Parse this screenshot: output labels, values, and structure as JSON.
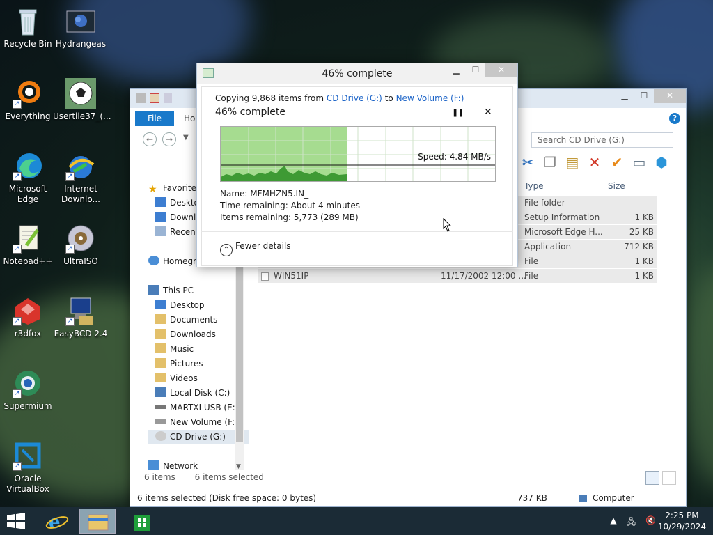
{
  "desktop": {
    "icons": [
      {
        "label": "Recycle Bin"
      },
      {
        "label": "Hydrangeas"
      },
      {
        "label": "Everything"
      },
      {
        "label": "Usertile37_(..."
      },
      {
        "label": "Microsoft Edge"
      },
      {
        "label": "Internet Downlo..."
      },
      {
        "label": "Notepad++"
      },
      {
        "label": "UltraISO"
      },
      {
        "label": "r3dfox"
      },
      {
        "label": "EasyBCD 2.4"
      },
      {
        "label": "Supermium"
      },
      {
        "label": "Oracle VirtualBox"
      }
    ]
  },
  "explorer": {
    "tabs": {
      "file": "File",
      "home": "Ho"
    },
    "search_placeholder": "Search CD Drive (G:)",
    "sidebar": [
      {
        "label": "Favorites"
      },
      {
        "label": "Deskto"
      },
      {
        "label": "Downl"
      },
      {
        "label": "Recent"
      },
      {
        "label": "Homegr"
      },
      {
        "label": "This PC"
      },
      {
        "label": "Desktop"
      },
      {
        "label": "Documents"
      },
      {
        "label": "Downloads"
      },
      {
        "label": "Music"
      },
      {
        "label": "Pictures"
      },
      {
        "label": "Videos"
      },
      {
        "label": "Local Disk (C:)"
      },
      {
        "label": "MARTXI USB (E:)"
      },
      {
        "label": "New Volume (F:)"
      },
      {
        "label": "CD Drive (G:)"
      },
      {
        "label": "Network"
      }
    ],
    "columns": {
      "type": "Type",
      "size": "Size"
    },
    "files": [
      {
        "name": "",
        "date": "",
        "type": "File folder",
        "size": ""
      },
      {
        "name": "",
        "date": "",
        "type": "Setup Information",
        "size": "1 KB"
      },
      {
        "name": "",
        "date": "",
        "type": "Microsoft Edge H...",
        "size": "25 KB"
      },
      {
        "name": "",
        "date": "",
        "type": "Application",
        "size": "712 KB"
      },
      {
        "name": "",
        "date": "",
        "type": "File",
        "size": "1 KB"
      },
      {
        "name": "WIN51IP",
        "date": "11/17/2002 12:00 ...",
        "type": "File",
        "size": "1 KB"
      }
    ],
    "items_count": "6 items",
    "items_selected": "6 items selected",
    "status_left": "6 items selected (Disk free space: 0 bytes)",
    "status_size": "737 KB",
    "status_location": "Computer"
  },
  "copy_dialog": {
    "title": "46% complete",
    "copying_prefix": "Copying 9,868 items from",
    "source": "CD Drive (G:)",
    "to_word": "to",
    "destination": "New Volume (F:)",
    "percent_label": "46% complete",
    "progress": 0.46,
    "speed": "Speed: 4.84 MB/s",
    "name_label": "Name:",
    "name_value": "MFMHZN5.IN_",
    "time_label": "Time remaining:",
    "time_value": "About 4 minutes",
    "items_label": "Items remaining:",
    "items_value": "5,773 (289 MB)",
    "fewer_details": "Fewer details",
    "colors": {
      "progress_fill": "#a6dc90",
      "graph_area": "#3e9a34"
    }
  },
  "taskbar": {
    "time": "2:25 PM",
    "date": "10/29/2024"
  }
}
